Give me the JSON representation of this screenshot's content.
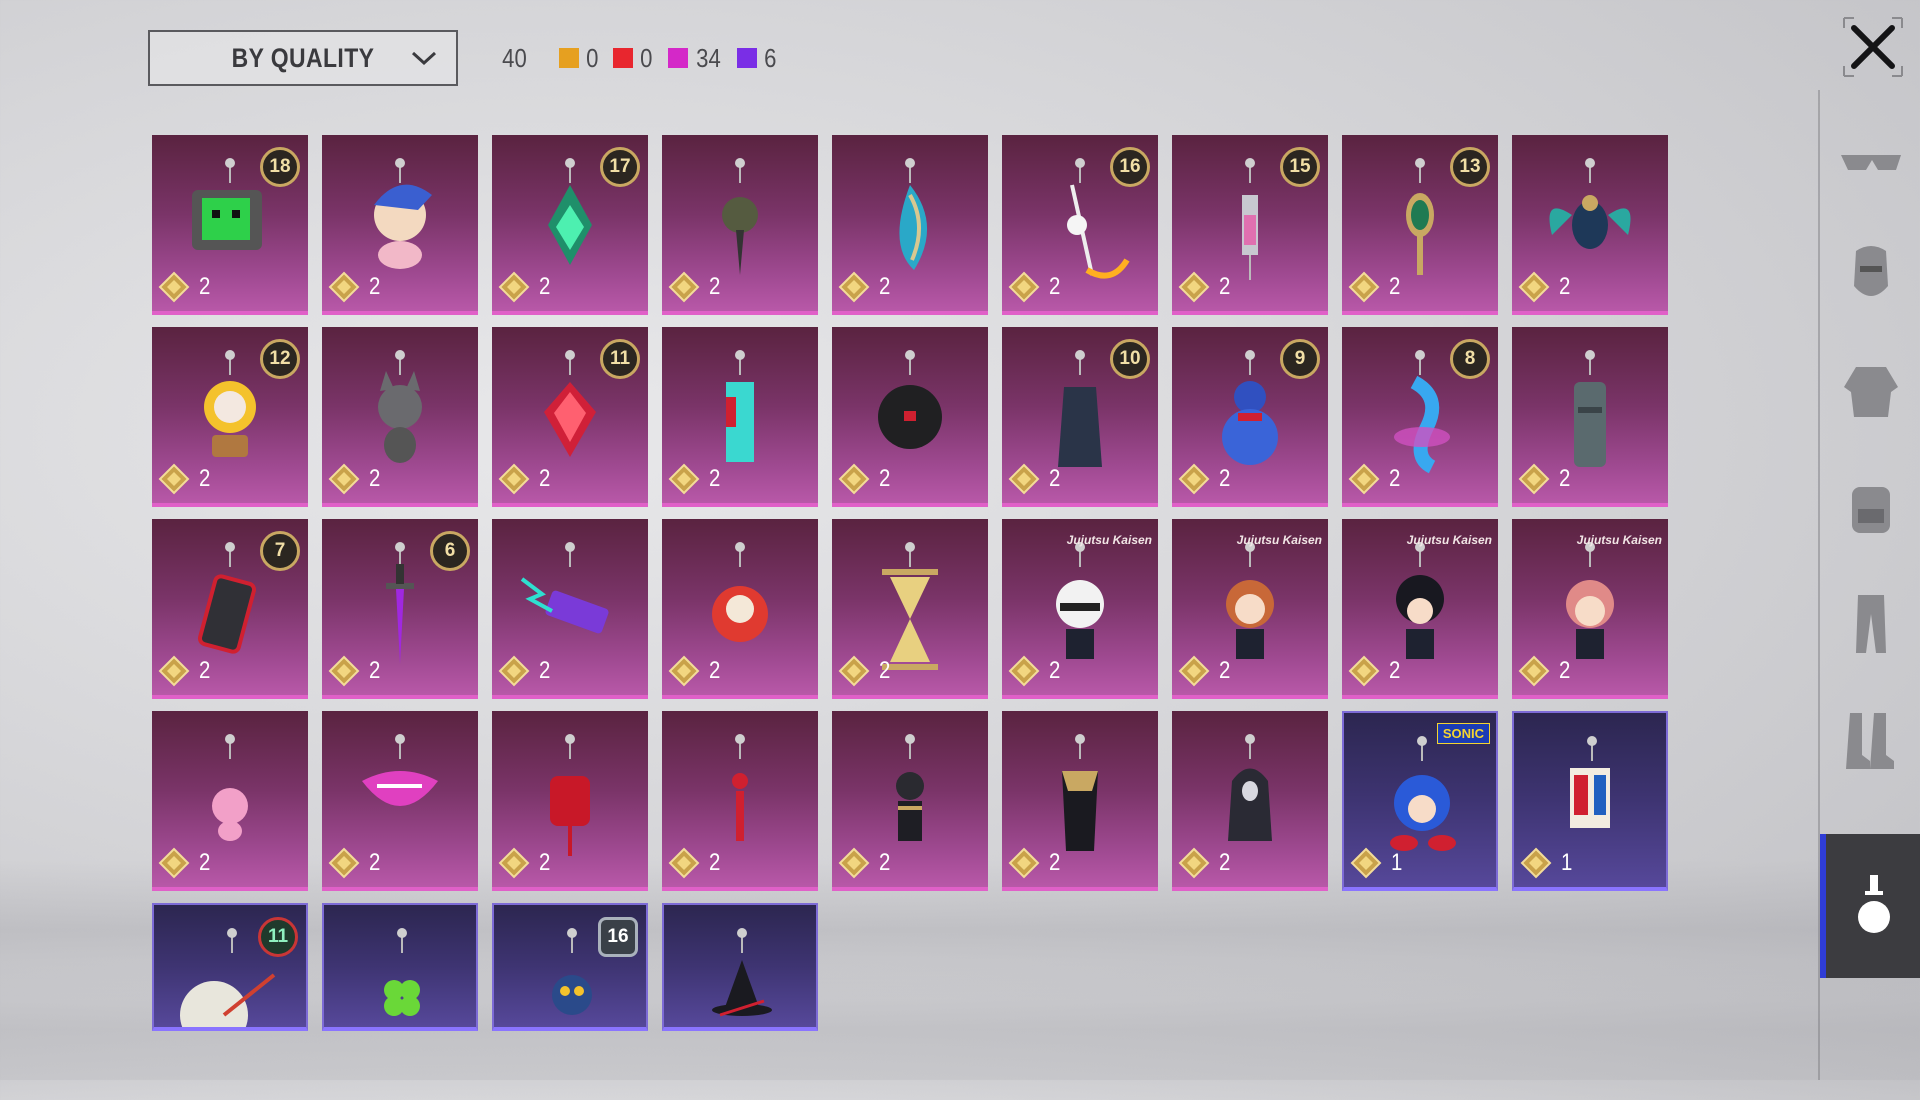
{
  "sort": {
    "label": "BY QUALITY"
  },
  "counts": {
    "total": "40",
    "by_quality": [
      {
        "color": "#e6a020",
        "value": "0"
      },
      {
        "color": "#e8262e",
        "value": "0"
      },
      {
        "color": "#d428c8",
        "value": "34"
      },
      {
        "color": "#7a2ee6",
        "value": "6"
      }
    ]
  },
  "items": [
    {
      "name": "item-tv-monitor",
      "icon": "green-tv-icon",
      "badge": "18",
      "cost": "2",
      "quality": "pink"
    },
    {
      "name": "item-blonde-plush",
      "icon": "plush-doll-icon",
      "cost": "2",
      "quality": "pink"
    },
    {
      "name": "item-green-crystal",
      "icon": "green-crystal-icon",
      "badge": "17",
      "cost": "2",
      "quality": "pink"
    },
    {
      "name": "item-dark-pendant",
      "icon": "dark-pendant-icon",
      "cost": "2",
      "quality": "pink"
    },
    {
      "name": "item-blue-shell",
      "icon": "blue-shell-icon",
      "cost": "2",
      "quality": "pink"
    },
    {
      "name": "item-cat-scythe",
      "icon": "scythe-icon",
      "badge": "16",
      "cost": "2",
      "quality": "pink"
    },
    {
      "name": "item-syringe",
      "icon": "syringe-icon",
      "badge": "15",
      "cost": "2",
      "quality": "pink"
    },
    {
      "name": "item-bunny-mirror",
      "icon": "mirror-icon",
      "badge": "13",
      "cost": "2",
      "quality": "pink"
    },
    {
      "name": "item-scarab",
      "icon": "scarab-icon",
      "cost": "2",
      "quality": "pink"
    },
    {
      "name": "item-sunflower",
      "icon": "sunflower-icon",
      "badge": "12",
      "cost": "2",
      "quality": "pink"
    },
    {
      "name": "item-gray-cat",
      "icon": "cat-icon",
      "cost": "2",
      "quality": "pink"
    },
    {
      "name": "item-red-gem",
      "icon": "red-gem-icon",
      "badge": "11",
      "cost": "2",
      "quality": "pink"
    },
    {
      "name": "item-teal-cloth",
      "icon": "cloth-icon",
      "cost": "2",
      "quality": "pink"
    },
    {
      "name": "item-black-orb",
      "icon": "black-orb-icon",
      "cost": "2",
      "quality": "pink"
    },
    {
      "name": "item-dark-cloak",
      "icon": "cloak-icon",
      "badge": "10",
      "cost": "2",
      "quality": "pink"
    },
    {
      "name": "item-blue-gourd",
      "icon": "gourd-icon",
      "badge": "9",
      "cost": "2",
      "quality": "pink"
    },
    {
      "name": "item-seahorse",
      "icon": "seahorse-icon",
      "badge": "8",
      "cost": "2",
      "quality": "pink"
    },
    {
      "name": "item-moai",
      "icon": "moai-icon",
      "cost": "2",
      "quality": "pink"
    },
    {
      "name": "item-red-phone",
      "icon": "phone-icon",
      "badge": "7",
      "cost": "2",
      "quality": "pink"
    },
    {
      "name": "item-purple-dagger",
      "icon": "dagger-icon",
      "badge": "6",
      "cost": "2",
      "quality": "pink"
    },
    {
      "name": "item-energy-battery",
      "icon": "battery-icon",
      "cost": "2",
      "quality": "pink"
    },
    {
      "name": "item-daruma",
      "icon": "daruma-icon",
      "cost": "2",
      "quality": "pink"
    },
    {
      "name": "item-hourglass",
      "icon": "hourglass-icon",
      "cost": "2",
      "quality": "pink"
    },
    {
      "name": "item-jjk-white-hair",
      "icon": "chibi-white-icon",
      "brand": "Jujutsu Kaisen",
      "cost": "2",
      "quality": "pink"
    },
    {
      "name": "item-jjk-orange-hair",
      "icon": "chibi-orange-icon",
      "brand": "Jujutsu Kaisen",
      "cost": "2",
      "quality": "pink"
    },
    {
      "name": "item-jjk-black-hair",
      "icon": "chibi-black-icon",
      "brand": "Jujutsu Kaisen",
      "cost": "2",
      "quality": "pink"
    },
    {
      "name": "item-jjk-pink-hair",
      "icon": "chibi-pink-icon",
      "brand": "Jujutsu Kaisen",
      "cost": "2",
      "quality": "pink"
    },
    {
      "name": "item-pink-pig",
      "icon": "pig-icon",
      "cost": "2",
      "quality": "pink"
    },
    {
      "name": "item-pink-lips",
      "icon": "lips-icon",
      "cost": "2",
      "quality": "pink"
    },
    {
      "name": "item-red-lantern",
      "icon": "lantern-icon",
      "cost": "2",
      "quality": "pink"
    },
    {
      "name": "item-red-tassel",
      "icon": "tassel-icon",
      "cost": "2",
      "quality": "pink"
    },
    {
      "name": "item-black-warrior",
      "icon": "warrior-icon",
      "cost": "2",
      "quality": "pink"
    },
    {
      "name": "item-gold-anubis",
      "icon": "anubis-icon",
      "cost": "2",
      "quality": "pink"
    },
    {
      "name": "item-hooded-reaper",
      "icon": "reaper-icon",
      "cost": "2",
      "quality": "pink"
    },
    {
      "name": "item-sonic",
      "icon": "sonic-icon",
      "brand_sonic": "SONIC",
      "cost": "1",
      "quality": "purple"
    },
    {
      "name": "item-scroll-runner",
      "icon": "scroll-icon",
      "cost": "1",
      "quality": "purple"
    },
    {
      "name": "item-white-fan",
      "icon": "fan-icon",
      "badge": "11",
      "badge_style": "alt",
      "quality": "purple",
      "partial": true
    },
    {
      "name": "item-green-clover",
      "icon": "clover-icon",
      "quality": "purple",
      "partial": true
    },
    {
      "name": "item-owl-knight",
      "icon": "owl-icon",
      "badge": "16",
      "badge_style": "alt2",
      "quality": "purple",
      "partial": true
    },
    {
      "name": "item-witch-hat",
      "icon": "witch-hat-icon",
      "quality": "purple",
      "partial": true
    }
  ],
  "sidebar": [
    {
      "name": "tab-eyewear",
      "icon": "glasses-icon"
    },
    {
      "name": "tab-mask",
      "icon": "mask-icon"
    },
    {
      "name": "tab-top",
      "icon": "jacket-icon"
    },
    {
      "name": "tab-backpack",
      "icon": "backpack-icon"
    },
    {
      "name": "tab-pants",
      "icon": "pants-icon"
    },
    {
      "name": "tab-shoes",
      "icon": "boots-icon"
    },
    {
      "name": "tab-pendant",
      "icon": "pendant-icon",
      "active": true
    }
  ]
}
